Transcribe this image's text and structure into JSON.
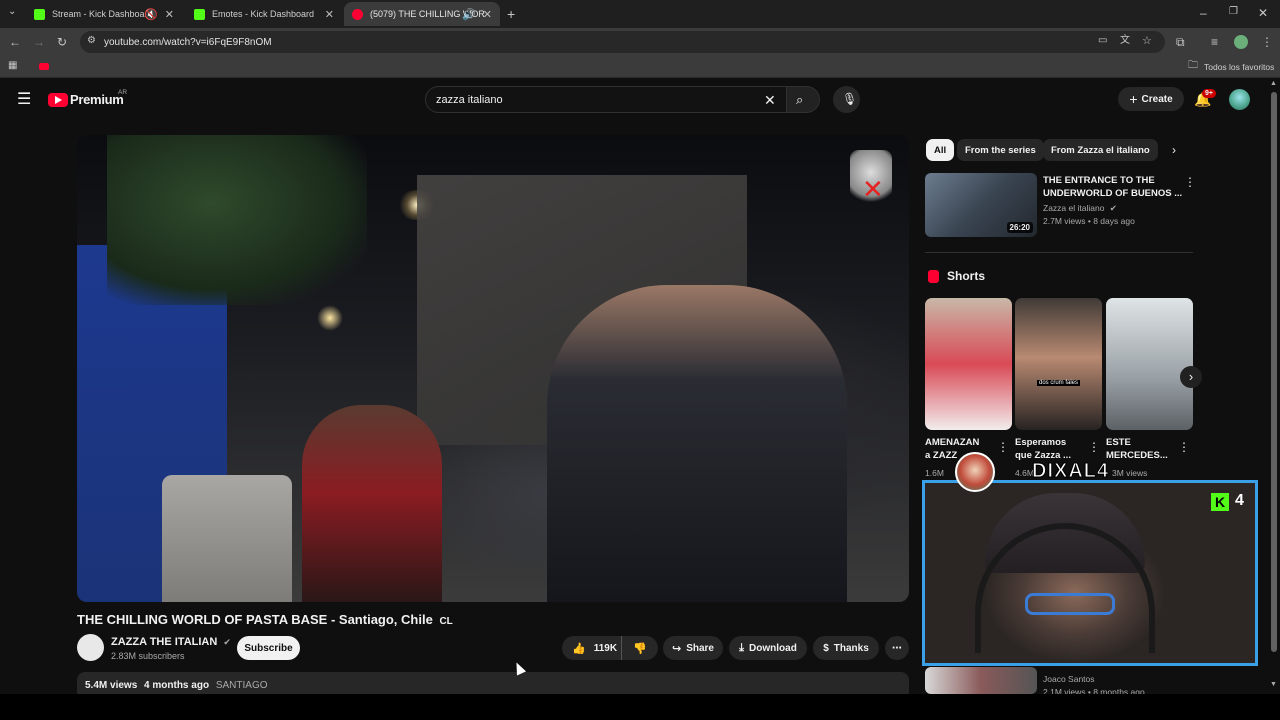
{
  "browser": {
    "tabs": [
      {
        "title": "Stream - Kick Dashboard"
      },
      {
        "title": "Emotes - Kick Dashboard"
      },
      {
        "title": "(5079) THE CHILLING WOR"
      }
    ],
    "url": "youtube.com/watch?v=i6FqE9F8nOM",
    "bookmarks_label": "Todos los favoritos"
  },
  "youtube": {
    "logo_text": "Premium",
    "region": "AR",
    "search_value": "zazza italiano",
    "create_label": "Create",
    "notif_count": "9+"
  },
  "video": {
    "title": "THE CHILLING WORLD OF PASTA BASE - Santiago, Chile",
    "flag": "CL",
    "channel": "ZAZZA THE ITALIAN",
    "subscribers": "2.83M subscribers",
    "subscribe_label": "Subscribe",
    "likes": "119K",
    "share_label": "Share",
    "download_label": "Download",
    "thanks_label": "Thanks",
    "views": "5.4M views",
    "age": "4 months ago",
    "location": "SANTIAGO"
  },
  "sidebar": {
    "chips": [
      "All",
      "From the series",
      "From Zazza el italiano"
    ],
    "recommended": {
      "title_line1": "THE ENTRANCE TO THE",
      "title_line2": "UNDERWORLD OF BUENOS ...",
      "channel": "Zazza el italiano",
      "meta": "2.7M views • 8 days ago",
      "duration": "26:20"
    },
    "shorts_heading": "Shorts",
    "shorts": [
      {
        "title_line1": "AMENAZAN",
        "title_line2": "a ZAZZ",
        "views": "1.6M"
      },
      {
        "title_line1": "Esperamos",
        "title_line2": "que Zazza ...",
        "views": "4.6M"
      },
      {
        "title_line1": "ESTE",
        "title_line2": "MERCEDES...",
        "views": "3M views"
      }
    ],
    "bottom_item": {
      "channel": "Joaco Santos",
      "meta": "2.1M views • 8 months ago"
    }
  },
  "overlay": {
    "streamer_name": "DIXAL4",
    "kick_count": "4",
    "caption": "dos crum fales"
  },
  "colors": {
    "youtube_red": "#ff0033",
    "kick_green": "#53fc18",
    "cam_border": "#3aa0e8"
  }
}
